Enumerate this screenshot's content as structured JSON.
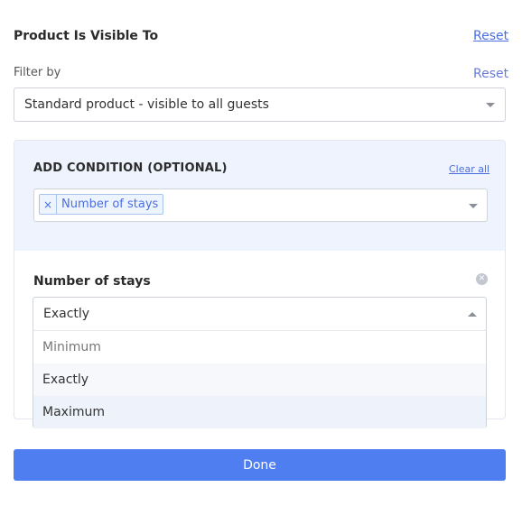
{
  "header": {
    "title": "Product Is Visible To",
    "reset_label": "Reset"
  },
  "filter": {
    "label": "Filter by",
    "reset_label": "Reset",
    "selected": "Standard product - visible to all guests"
  },
  "condition": {
    "title": "ADD CONDITION (OPTIONAL)",
    "clear_all_label": "Clear all",
    "tags": [
      {
        "remove_glyph": "×",
        "label": "Number of stays"
      }
    ]
  },
  "stays": {
    "title": "Number of stays",
    "remove_glyph": "✕",
    "selected": "Exactly",
    "options": [
      "Minimum",
      "Exactly",
      "Maximum"
    ]
  },
  "footer": {
    "done_label": "Done"
  },
  "colors": {
    "accent": "#4f7ef0",
    "link": "#4a6ee0",
    "card_header_bg": "#eef3fd"
  }
}
